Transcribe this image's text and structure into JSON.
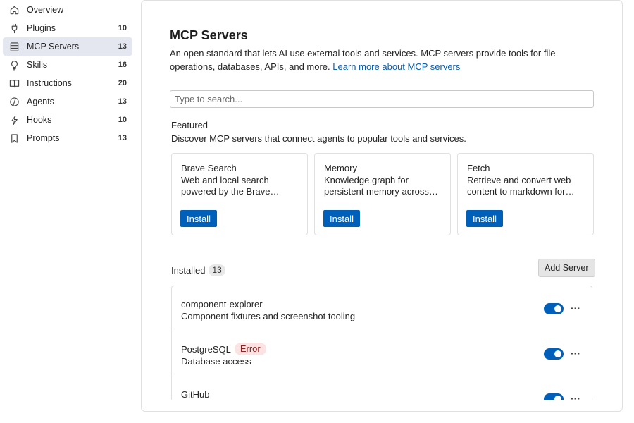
{
  "sidebar": {
    "items": [
      {
        "label": "Overview",
        "count": "",
        "icon": "home-icon",
        "active": false
      },
      {
        "label": "Plugins",
        "count": "10",
        "icon": "plug-icon",
        "active": false
      },
      {
        "label": "MCP Servers",
        "count": "13",
        "icon": "server-icon",
        "active": true
      },
      {
        "label": "Skills",
        "count": "16",
        "icon": "lightbulb-icon",
        "active": false
      },
      {
        "label": "Instructions",
        "count": "20",
        "icon": "book-icon",
        "active": false
      },
      {
        "label": "Agents",
        "count": "13",
        "icon": "agent-icon",
        "active": false
      },
      {
        "label": "Hooks",
        "count": "10",
        "icon": "lightning-icon",
        "active": false
      },
      {
        "label": "Prompts",
        "count": "13",
        "icon": "bookmark-icon",
        "active": false
      }
    ]
  },
  "main": {
    "title": "MCP Servers",
    "description": "An open standard that lets AI use external tools and services. MCP servers provide tools for file operations, databases, APIs, and more.",
    "learn_more_link": "Learn more about MCP servers",
    "search_placeholder": "Type to search...",
    "featured": {
      "title": "Featured",
      "subtitle": "Discover MCP servers that connect agents to popular tools and services.",
      "cards": [
        {
          "name": "Brave Search",
          "description": "Web and local search powered by the Brave…",
          "button": "Install"
        },
        {
          "name": "Memory",
          "description": "Knowledge graph for persistent memory across…",
          "button": "Install"
        },
        {
          "name": "Fetch",
          "description": "Retrieve and convert web content to markdown for…",
          "button": "Install"
        }
      ]
    },
    "installed": {
      "label": "Installed",
      "count": "13",
      "add_button": "Add Server",
      "servers": [
        {
          "name": "component-explorer",
          "description": "Component fixtures and screenshot tooling",
          "badge": "",
          "enabled": true
        },
        {
          "name": "PostgreSQL",
          "description": "Database access",
          "badge": "Error",
          "enabled": true
        },
        {
          "name": "GitHub",
          "description": "",
          "badge": "",
          "enabled": true
        }
      ]
    }
  },
  "colors": {
    "accent": "#005fb8",
    "link": "#0b5cad",
    "active_nav_bg": "#e4e7ef",
    "error_badge_bg": "#fbe3e3"
  }
}
